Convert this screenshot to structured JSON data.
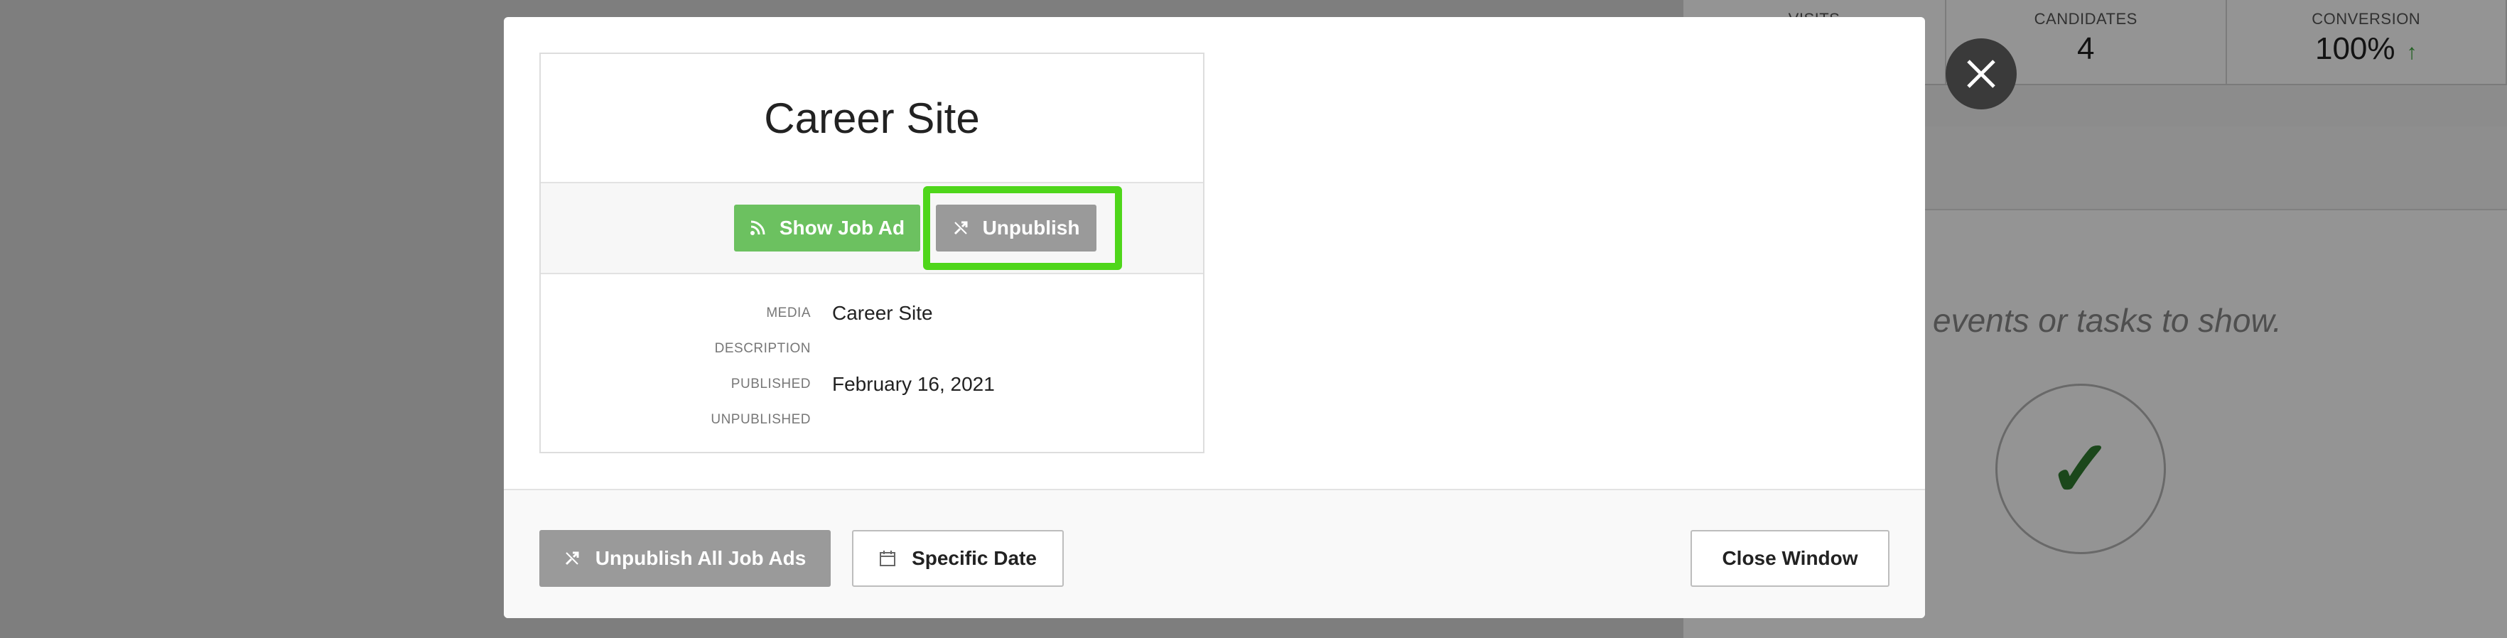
{
  "background": {
    "stats": [
      {
        "label": "VISITS",
        "value": ""
      },
      {
        "label": "CANDIDATES",
        "value": "4"
      },
      {
        "label": "CONVERSION",
        "value": "100%",
        "trend_icon": "arrow-up-icon"
      }
    ],
    "empty_message": "events or tasks to show."
  },
  "modal": {
    "job_card": {
      "title": "Career Site",
      "show_button_label": "Show Job Ad",
      "unpublish_button_label": "Unpublish",
      "details": [
        {
          "label": "MEDIA",
          "value": "Career Site"
        },
        {
          "label": "DESCRIPTION",
          "value": ""
        },
        {
          "label": "PUBLISHED",
          "value": "February 16, 2021"
        },
        {
          "label": "UNPUBLISHED",
          "value": ""
        }
      ]
    },
    "footer": {
      "unpublish_all_label": "Unpublish All Job Ads",
      "specific_date_label": "Specific Date",
      "close_window_label": "Close Window"
    }
  },
  "colors": {
    "green_button": "#6cc160",
    "highlight": "#4fd61b",
    "gray_button": "#9a9a9a",
    "trend": "#3aa53a"
  }
}
